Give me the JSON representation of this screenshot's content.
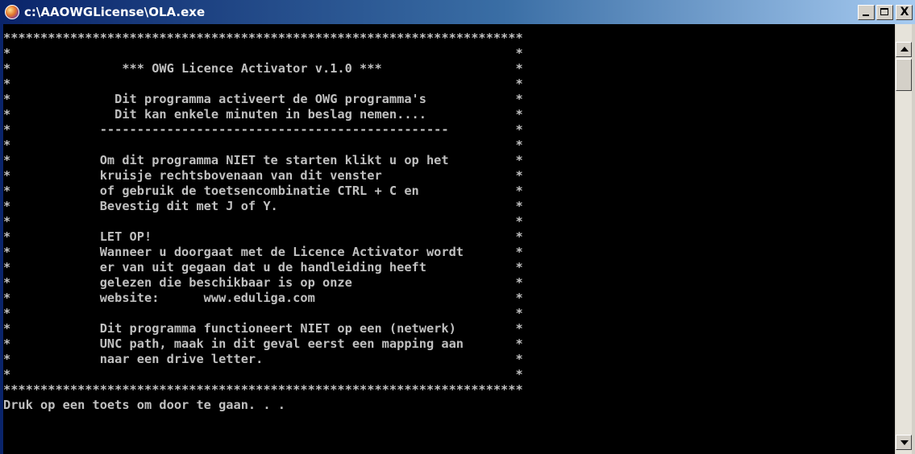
{
  "window": {
    "title": "c:\\AAOWGLicense\\OLA.exe",
    "icon": "console-app-icon",
    "controls": {
      "minimize": "minimize-icon",
      "maximize": "maximize-icon",
      "close_label": "X"
    }
  },
  "console": {
    "lines": [
      "**********************************************************************",
      "*                                                                    *",
      "*               *** OWG Licence Activator v.1.0 ***                  *",
      "*                                                                    *",
      "*              Dit programma activeert de OWG programma's            *",
      "*              Dit kan enkele minuten in beslag nemen....            *",
      "*            -----------------------------------------------         *",
      "*                                                                    *",
      "*            Om dit programma NIET te starten klikt u op het         *",
      "*            kruisje rechtsbovenaan van dit venster                  *",
      "*            of gebruik de toetsencombinatie CTRL + C en             *",
      "*            Bevestig dit met J of Y.                                *",
      "*                                                                    *",
      "*            LET OP!                                                 *",
      "*            Wanneer u doorgaat met de Licence Activator wordt       *",
      "*            er van uit gegaan dat u de handleiding heeft            *",
      "*            gelezen die beschikbaar is op onze                      *",
      "*            website:      www.eduliga.com                           *",
      "*                                                                    *",
      "*            Dit programma functioneert NIET op een (netwerk)        *",
      "*            UNC path, maak in dit geval eerst een mapping aan       *",
      "*            naar een drive letter.                                  *",
      "*                                                                    *",
      "**********************************************************************",
      "Druk op een toets om door te gaan. . ."
    ]
  },
  "scrollbar": {
    "up": "scroll-up-icon",
    "down": "scroll-down-icon"
  },
  "colors": {
    "console_bg": "#000000",
    "console_text": "#c0c0c0",
    "titlebar": "#0a246a",
    "chrome": "#d4d0c8"
  }
}
